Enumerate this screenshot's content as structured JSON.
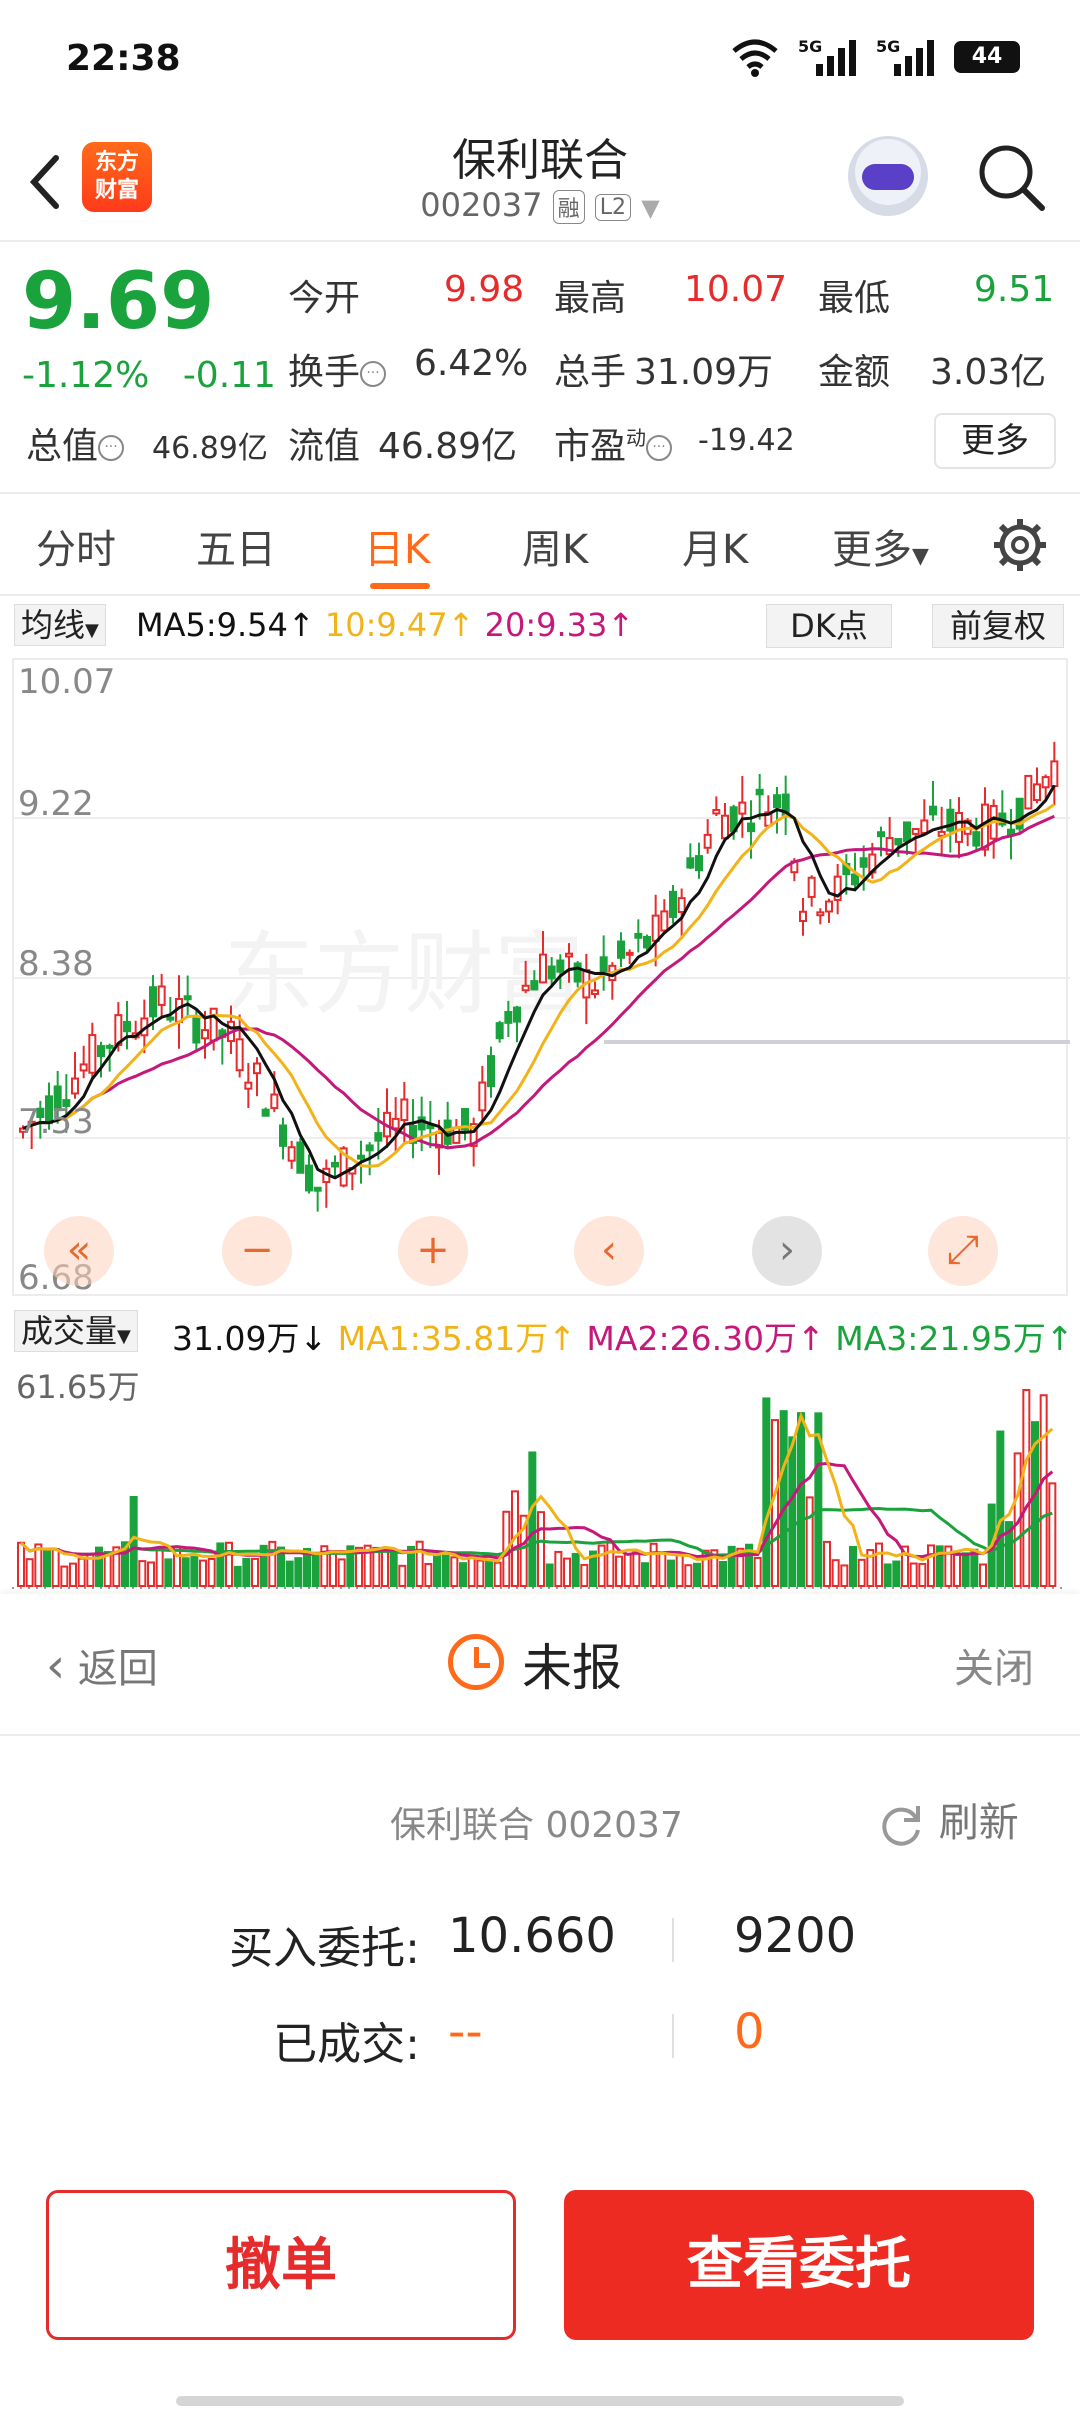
{
  "status_bar": {
    "time": "22:38",
    "network1": "5G",
    "network2": "5G",
    "battery": "44"
  },
  "header": {
    "logo_line1": "东方",
    "logo_line2": "财富",
    "stock_name": "保利联合",
    "stock_code": "002037",
    "tag_margin": "融",
    "tag_level": "L2"
  },
  "quote": {
    "price": "9.69",
    "change_pct": "-1.12%",
    "change_abs": "-0.11",
    "open_label": "今开",
    "open_value": "9.98",
    "high_label": "最高",
    "high_value": "10.07",
    "low_label": "最低",
    "low_value": "9.51",
    "turnover_label": "换手",
    "turnover_value": "6.42%",
    "volume_label": "总手",
    "volume_value": "31.09万",
    "amount_label": "金额",
    "amount_value": "3.03亿",
    "mcap_label": "总值",
    "mcap_value": "46.89亿",
    "float_label": "流值",
    "float_value": "46.89亿",
    "pe_label": "市盈",
    "pe_sup": "动",
    "pe_value": "-19.42",
    "more_label": "更多"
  },
  "tabs": [
    "分时",
    "五日",
    "日K",
    "周K",
    "月K",
    "更多"
  ],
  "active_tab": "日K",
  "ma_bar": {
    "select_label": "均线",
    "ma5": "MA5:9.54↑",
    "ma10": "10:9.47↑",
    "ma20": "20:9.33↑",
    "dk_label": "DK点",
    "adjust_label": "前复权"
  },
  "kchart": {
    "y_labels": [
      "10.07",
      "9.22",
      "8.38",
      "7.53",
      "6.68"
    ],
    "watermark": "东方财富"
  },
  "vol_bar": {
    "select_label": "成交量",
    "vol": "31.09万↓",
    "ma1": "MA1:35.81万↑",
    "ma2": "MA2:26.30万↑",
    "ma3": "MA3:21.95万↑",
    "ymax": "61.65万"
  },
  "panel": {
    "back_label": "返回",
    "status": "未报",
    "close_label": "关闭",
    "order_stock": "保利联合 002037",
    "refresh_label": "刷新",
    "buy_label": "买入委托:",
    "buy_price": "10.660",
    "buy_qty": "9200",
    "filled_label": "已成交:",
    "filled_price": "--",
    "filled_qty": "0"
  },
  "buttons": {
    "cancel": "撤单",
    "view": "查看委托"
  },
  "colors": {
    "up": "#e52b2b",
    "down": "#1aa23c",
    "accent": "#ff6a1a",
    "ma5": "#111111",
    "ma10": "#f2b318",
    "ma20": "#c4187a"
  }
}
